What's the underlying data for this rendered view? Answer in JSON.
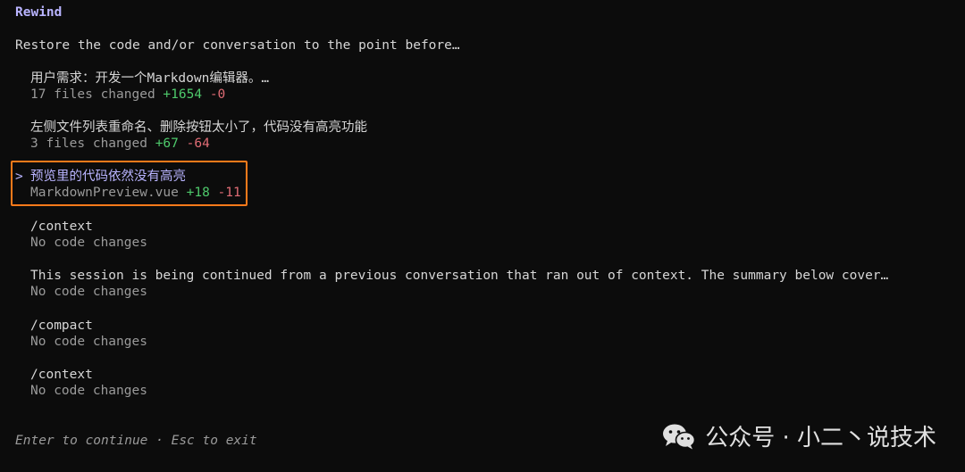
{
  "header": {
    "title": "Rewind",
    "prompt": "Restore the code and/or conversation to the point before…"
  },
  "items": [
    {
      "title": "用户需求：开发一个Markdown编辑器。…",
      "prefix": "17 files changed",
      "add": "+1654",
      "del": "-0"
    },
    {
      "title": "左侧文件列表重命名、删除按钮太小了，代码没有高亮功能",
      "prefix": "3 files changed",
      "add": "+67",
      "del": "-64"
    },
    {
      "title": "预览里的代码依然没有高亮",
      "prefix": "MarkdownPreview.vue",
      "add": "+18",
      "del": "-11",
      "selected": true
    },
    {
      "title": "/context",
      "sub": "No code changes"
    },
    {
      "title": "This session is being continued from a previous conversation that ran out of context. The summary below cover…",
      "sub": "No code changes"
    },
    {
      "title": "/compact",
      "sub": "No code changes"
    },
    {
      "title": "/context",
      "sub": "No code changes"
    }
  ],
  "selection_marker": ">",
  "footer": {
    "hint": "Enter to continue · Esc to exit"
  },
  "watermark": {
    "text": "公众号 · 小二丶说技术"
  },
  "colors": {
    "background": "#0c0c0c",
    "accent": "#b9b4ff",
    "added": "#4ec96b",
    "removed": "#e06c75",
    "highlight_border": "#ff7a1a"
  }
}
